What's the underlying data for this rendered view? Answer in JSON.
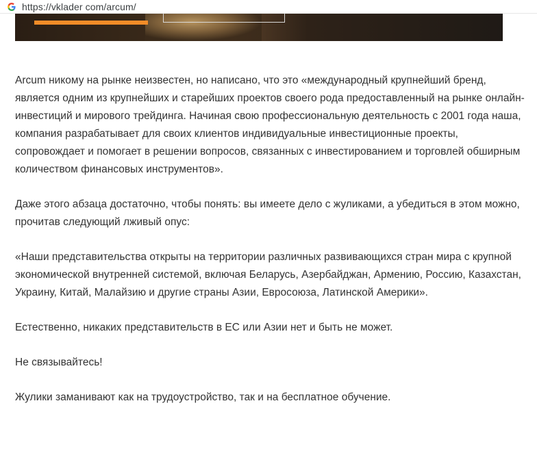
{
  "browser": {
    "url": "https://vklader com/arcum/",
    "icon": "google-g-icon"
  },
  "banner": {
    "accent_color": "#f28c28",
    "progress": 0.23
  },
  "article": {
    "paragraphs": [
      "Arcum никому на рынке неизвестен, но написано, что это «международный крупнейший бренд, является одним из крупнейших и старейших проектов своего рода предоставленный на рынке онлайн-инвестиций и мирового трейдинга. Начиная свою профессиональную деятельность с 2001 года наша, компания разрабатывает для своих клиентов индивидуальные инвестиционные проекты, сопровождает и помогает в решении вопросов, связанных с инвестированием и торговлей обширным количеством финансовых инструментов».",
      "Даже этого абзаца достаточно, чтобы понять: вы имеете дело с жуликами, а убедиться в этом можно, прочитав следующий лживый опус:",
      "«Наши представительства открыты на территории различных развивающихся стран мира с крупной экономической внутренней системой, включая Беларусь, Азербайджан, Армению, Россию, Казахстан, Украину, Китай, Малайзию и другие страны Азии, Евросоюза, Латинской Америки».",
      "Естественно, никаких представительств в ЕС или Азии нет и быть не может.",
      "Не связывайтесь!",
      "Жулики заманивают как на трудоустройство, так и на бесплатное обучение."
    ]
  }
}
